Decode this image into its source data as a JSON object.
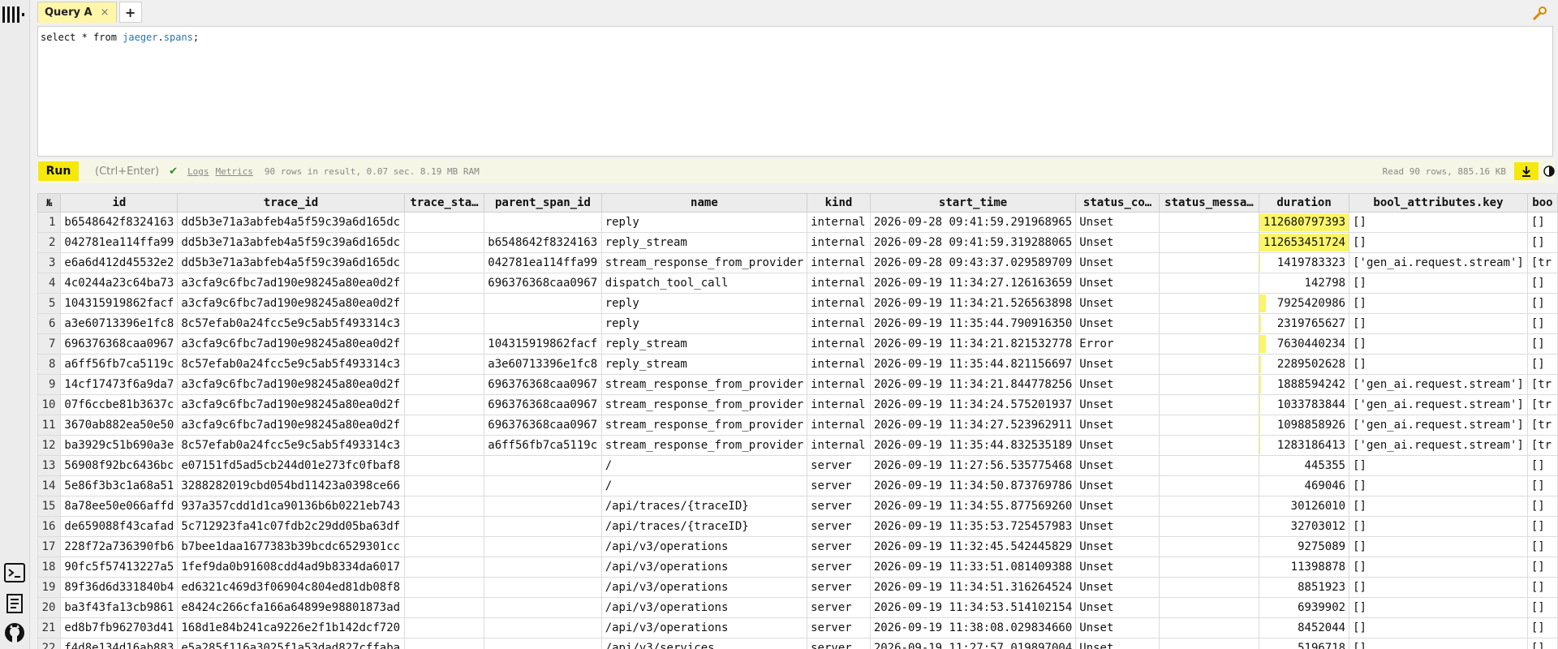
{
  "app": {
    "tabs": [
      {
        "label": "Query A",
        "close": "×"
      }
    ],
    "add_tab": "+"
  },
  "icons": {
    "logo": "bars-logo-icon",
    "top_right": "wrench-icon",
    "terminal": "terminal-icon",
    "doc": "document-icon",
    "github": "github-icon",
    "download": "download-icon",
    "theme": "contrast-icon"
  },
  "colors": {
    "accent": "#f5e80a",
    "duration_bar": "#fbf56a",
    "identifier": "#2276b4"
  },
  "editor": {
    "keyword1": "select * from ",
    "schema": "jaeger",
    "dot": ".",
    "table": "spans",
    "end": ";"
  },
  "toolbar": {
    "run_label": "Run",
    "shortcut": "(Ctrl+Enter)",
    "check": "✔",
    "logs_label": "Logs",
    "metrics_label": "Metrics",
    "stats": "90 rows in result, 0.07 sec. 8.19 MB RAM",
    "read_stats": "Read 90 rows, 885.16 KB"
  },
  "table": {
    "columns": [
      "№",
      "id",
      "trace_id",
      "trace_sta…",
      "parent_span_id",
      "name",
      "kind",
      "start_time",
      "status_co…",
      "status_messa…",
      "duration",
      "bool_attributes.key",
      "boo"
    ],
    "duration_max": 112680797393,
    "rows": [
      [
        "1",
        "b6548642f8324163",
        "dd5b3e71a3abfeb4a5f59c39a6d165dc",
        "",
        "",
        "reply",
        "internal",
        "2026-09-28 09:41:59.291968965",
        "Unset",
        "",
        "112680797393",
        "[]",
        "[]"
      ],
      [
        "2",
        "042781ea114ffa99",
        "dd5b3e71a3abfeb4a5f59c39a6d165dc",
        "",
        "b6548642f8324163",
        "reply_stream",
        "internal",
        "2026-09-28 09:41:59.319288065",
        "Unset",
        "",
        "112653451724",
        "[]",
        "[]"
      ],
      [
        "3",
        "e6a6d412d45532e2",
        "dd5b3e71a3abfeb4a5f59c39a6d165dc",
        "",
        "042781ea114ffa99",
        "stream_response_from_provider",
        "internal",
        "2026-09-28 09:43:37.029589709",
        "Unset",
        "",
        "1419783323",
        "['gen_ai.request.stream']",
        "[tr"
      ],
      [
        "4",
        "4c0244a23c64ba73",
        "a3cfa9c6fbc7ad190e98245a80ea0d2f",
        "",
        "696376368caa0967",
        "dispatch_tool_call",
        "internal",
        "2026-09-19 11:34:27.126163659",
        "Unset",
        "",
        "142798",
        "[]",
        "[]"
      ],
      [
        "5",
        "104315919862facf",
        "a3cfa9c6fbc7ad190e98245a80ea0d2f",
        "",
        "",
        "reply",
        "internal",
        "2026-09-19 11:34:21.526563898",
        "Unset",
        "",
        "7925420986",
        "[]",
        "[]"
      ],
      [
        "6",
        "a3e60713396e1fc8",
        "8c57efab0a24fcc5e9c5ab5f493314c3",
        "",
        "",
        "reply",
        "internal",
        "2026-09-19 11:35:44.790916350",
        "Unset",
        "",
        "2319765627",
        "[]",
        "[]"
      ],
      [
        "7",
        "696376368caa0967",
        "a3cfa9c6fbc7ad190e98245a80ea0d2f",
        "",
        "104315919862facf",
        "reply_stream",
        "internal",
        "2026-09-19 11:34:21.821532778",
        "Error",
        "",
        "7630440234",
        "[]",
        "[]"
      ],
      [
        "8",
        "a6ff56fb7ca5119c",
        "8c57efab0a24fcc5e9c5ab5f493314c3",
        "",
        "a3e60713396e1fc8",
        "reply_stream",
        "internal",
        "2026-09-19 11:35:44.821156697",
        "Unset",
        "",
        "2289502628",
        "[]",
        "[]"
      ],
      [
        "9",
        "14cf17473f6a9da7",
        "a3cfa9c6fbc7ad190e98245a80ea0d2f",
        "",
        "696376368caa0967",
        "stream_response_from_provider",
        "internal",
        "2026-09-19 11:34:21.844778256",
        "Unset",
        "",
        "1888594242",
        "['gen_ai.request.stream']",
        "[tr"
      ],
      [
        "10",
        "07f6ccbe81b3637c",
        "a3cfa9c6fbc7ad190e98245a80ea0d2f",
        "",
        "696376368caa0967",
        "stream_response_from_provider",
        "internal",
        "2026-09-19 11:34:24.575201937",
        "Unset",
        "",
        "1033783844",
        "['gen_ai.request.stream']",
        "[tr"
      ],
      [
        "11",
        "3670ab882ea50e50",
        "a3cfa9c6fbc7ad190e98245a80ea0d2f",
        "",
        "696376368caa0967",
        "stream_response_from_provider",
        "internal",
        "2026-09-19 11:34:27.523962911",
        "Unset",
        "",
        "1098858926",
        "['gen_ai.request.stream']",
        "[tr"
      ],
      [
        "12",
        "ba3929c51b690a3e",
        "8c57efab0a24fcc5e9c5ab5f493314c3",
        "",
        "a6ff56fb7ca5119c",
        "stream_response_from_provider",
        "internal",
        "2026-09-19 11:35:44.832535189",
        "Unset",
        "",
        "1283186413",
        "['gen_ai.request.stream']",
        "[tr"
      ],
      [
        "13",
        "56908f92bc6436bc",
        "e07151fd5ad5cb244d01e273fc0fbaf8",
        "",
        "",
        "/",
        "server",
        "2026-09-19 11:27:56.535775468",
        "Unset",
        "",
        "445355",
        "[]",
        "[]"
      ],
      [
        "14",
        "5e86f3b3c1a68a51",
        "3288282019cbd054bd11423a0398ce66",
        "",
        "",
        "/",
        "server",
        "2026-09-19 11:34:50.873769786",
        "Unset",
        "",
        "469046",
        "[]",
        "[]"
      ],
      [
        "15",
        "8a78ee50e066affd",
        "937a357cdd1d1ca90136b6b0221eb743",
        "",
        "",
        "/api/traces/{traceID}",
        "server",
        "2026-09-19 11:34:55.877569260",
        "Unset",
        "",
        "30126010",
        "[]",
        "[]"
      ],
      [
        "16",
        "de659088f43cafad",
        "5c712923fa41c07fdb2c29dd05ba63df",
        "",
        "",
        "/api/traces/{traceID}",
        "server",
        "2026-09-19 11:35:53.725457983",
        "Unset",
        "",
        "32703012",
        "[]",
        "[]"
      ],
      [
        "17",
        "228f72a736390fb6",
        "b7bee1daa1677383b39bcdc6529301cc",
        "",
        "",
        "/api/v3/operations",
        "server",
        "2026-09-19 11:32:45.542445829",
        "Unset",
        "",
        "9275089",
        "[]",
        "[]"
      ],
      [
        "18",
        "90fc5f57413227a5",
        "1fef9da0b91608cdd4ad9b8334da6017",
        "",
        "",
        "/api/v3/operations",
        "server",
        "2026-09-19 11:33:51.081409388",
        "Unset",
        "",
        "11398878",
        "[]",
        "[]"
      ],
      [
        "19",
        "89f36d6d331840b4",
        "ed6321c469d3f06904c804ed81db08f8",
        "",
        "",
        "/api/v3/operations",
        "server",
        "2026-09-19 11:34:51.316264524",
        "Unset",
        "",
        "8851923",
        "[]",
        "[]"
      ],
      [
        "20",
        "ba3f43fa13cb9861",
        "e8424c266cfa166a64899e98801873ad",
        "",
        "",
        "/api/v3/operations",
        "server",
        "2026-09-19 11:34:53.514102154",
        "Unset",
        "",
        "6939902",
        "[]",
        "[]"
      ],
      [
        "21",
        "ed8b7fb962703d41",
        "168d1e84b241ca9226e2f1b142dcf720",
        "",
        "",
        "/api/v3/operations",
        "server",
        "2026-09-19 11:38:08.029834660",
        "Unset",
        "",
        "8452044",
        "[]",
        "[]"
      ],
      [
        "22",
        "f4d8e134d16ab883",
        "e5a285f116a3025f1a53dad827cffaba",
        "",
        "",
        "/api/v3/services",
        "server",
        "2026-09-19 11:27:57.019897004",
        "Unset",
        "",
        "5196718",
        "[]",
        "[]"
      ]
    ]
  }
}
